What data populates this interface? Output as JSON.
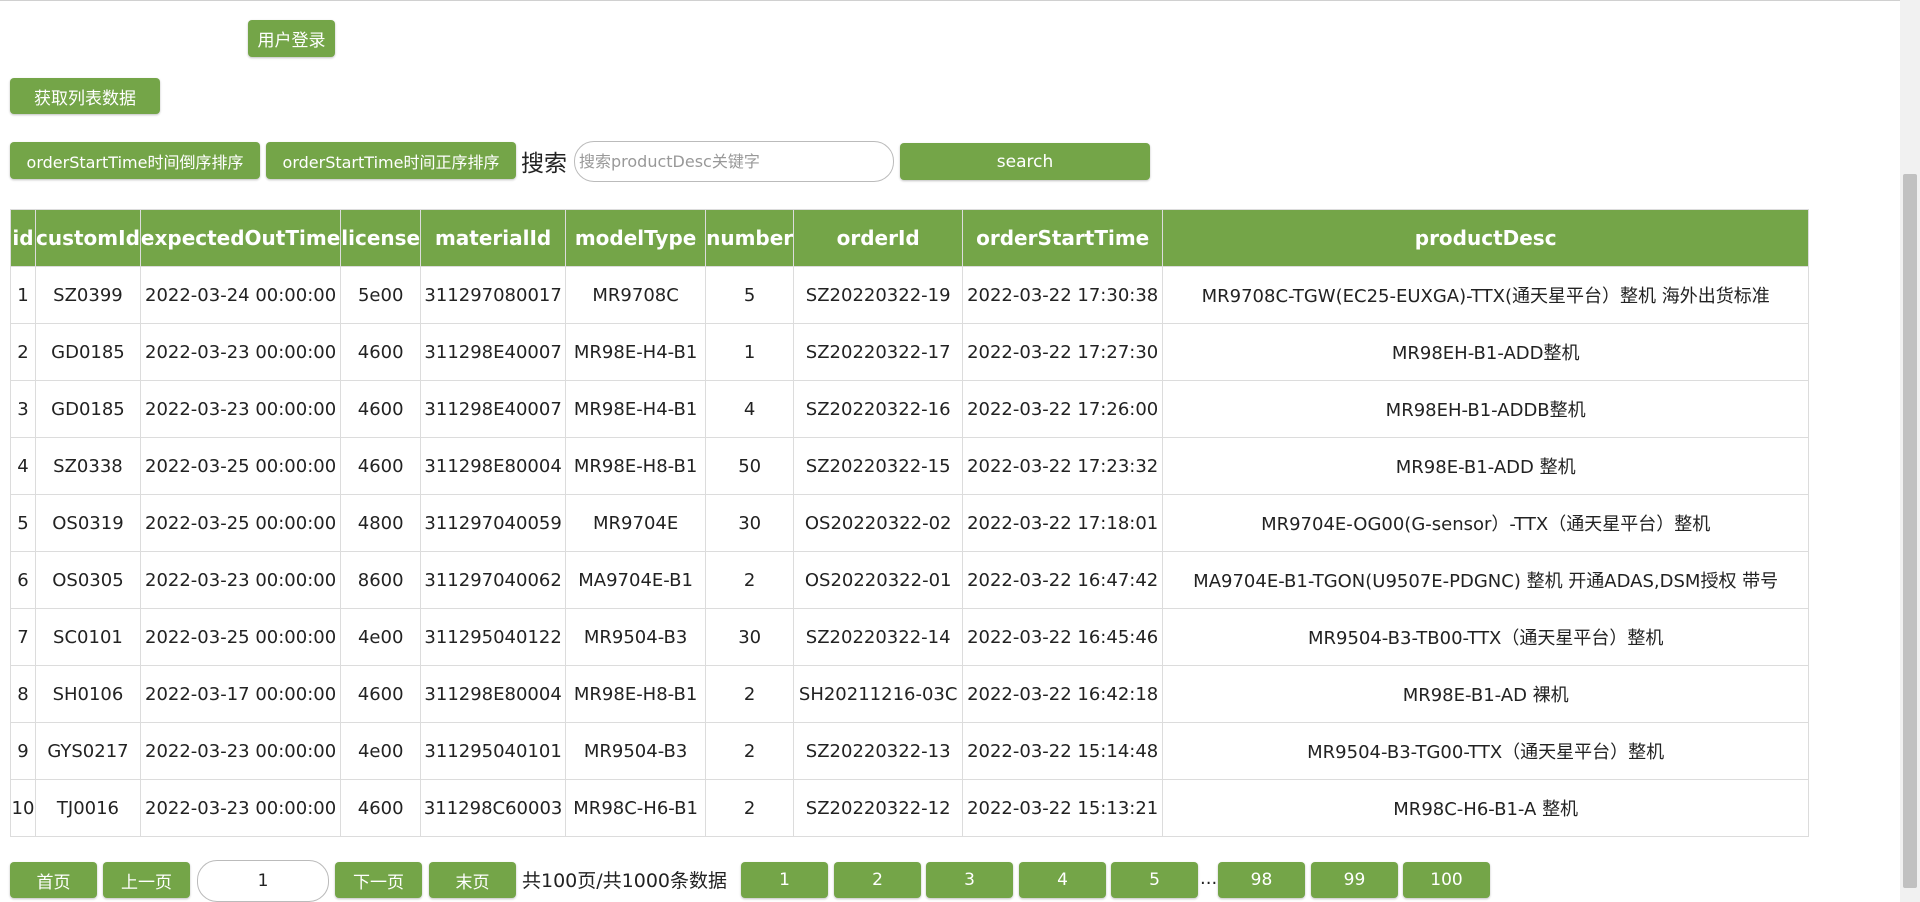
{
  "toolbar": {
    "login_label": "用户登录",
    "fetch_label": "获取列表数据",
    "sort_desc_label": "orderStartTime时间倒序排序",
    "sort_asc_label": "orderStartTime时间正序排序",
    "search_label": "搜索",
    "search_placeholder": "搜索productDesc关键字",
    "search_button": "search"
  },
  "table": {
    "columns": [
      "id",
      "customId",
      "expectedOutTime",
      "license",
      "materialId",
      "modelType",
      "number",
      "orderId",
      "orderStartTime",
      "productDesc"
    ],
    "rows": [
      [
        "1",
        "SZ0399",
        "2022-03-24 00:00:00",
        "5e00",
        "311297080017",
        "MR9708C",
        "5",
        "SZ20220322-19",
        "2022-03-22 17:30:38",
        "MR9708C-TGW(EC25-EUXGA)-TTX(通天星平台）整机 海外出货标准"
      ],
      [
        "2",
        "GD0185",
        "2022-03-23 00:00:00",
        "4600",
        "311298E40007",
        "MR98E-H4-B1",
        "1",
        "SZ20220322-17",
        "2022-03-22 17:27:30",
        "MR98EH-B1-ADD整机"
      ],
      [
        "3",
        "GD0185",
        "2022-03-23 00:00:00",
        "4600",
        "311298E40007",
        "MR98E-H4-B1",
        "4",
        "SZ20220322-16",
        "2022-03-22 17:26:00",
        "MR98EH-B1-ADDB整机"
      ],
      [
        "4",
        "SZ0338",
        "2022-03-25 00:00:00",
        "4600",
        "311298E80004",
        "MR98E-H8-B1",
        "50",
        "SZ20220322-15",
        "2022-03-22 17:23:32",
        "MR98E-B1-ADD 整机"
      ],
      [
        "5",
        "OS0319",
        "2022-03-25 00:00:00",
        "4800",
        "311297040059",
        "MR9704E",
        "30",
        "OS20220322-02",
        "2022-03-22 17:18:01",
        "MR9704E-OG00(G-sensor）-TTX（通天星平台）整机"
      ],
      [
        "6",
        "OS0305",
        "2022-03-23 00:00:00",
        "8600",
        "311297040062",
        "MA9704E-B1",
        "2",
        "OS20220322-01",
        "2022-03-22 16:47:42",
        "MA9704E-B1-TGON(U9507E-PDGNC) 整机 开通ADAS,DSM授权 带号"
      ],
      [
        "7",
        "SC0101",
        "2022-03-25 00:00:00",
        "4e00",
        "311295040122",
        "MR9504-B3",
        "30",
        "SZ20220322-14",
        "2022-03-22 16:45:46",
        "MR9504-B3-TB00-TTX（通天星平台）整机"
      ],
      [
        "8",
        "SH0106",
        "2022-03-17 00:00:00",
        "4600",
        "311298E80004",
        "MR98E-H8-B1",
        "2",
        "SH20211216-03C",
        "2022-03-22 16:42:18",
        "MR98E-B1-AD 裸机"
      ],
      [
        "9",
        "GYS0217",
        "2022-03-23 00:00:00",
        "4e00",
        "311295040101",
        "MR9504-B3",
        "2",
        "SZ20220322-13",
        "2022-03-22 15:14:48",
        "MR9504-B3-TG00-TTX（通天星平台）整机"
      ],
      [
        "10",
        "TJ0016",
        "2022-03-23 00:00:00",
        "4600",
        "311298C60003",
        "MR98C-H6-B1",
        "2",
        "SZ20220322-12",
        "2022-03-22 15:13:21",
        "MR98C-H6-B1-A 整机"
      ]
    ]
  },
  "pagination": {
    "first": "首页",
    "prev": "上一页",
    "current_page": "1",
    "next": "下一页",
    "last": "末页",
    "summary": "共100页/共1000条数据",
    "pages_before": [
      "1",
      "2",
      "3",
      "4",
      "5"
    ],
    "ellipsis": "...",
    "pages_after": [
      "98",
      "99",
      "100"
    ]
  },
  "colors": {
    "accent": "#74a548",
    "header_text": "#ffffff"
  }
}
